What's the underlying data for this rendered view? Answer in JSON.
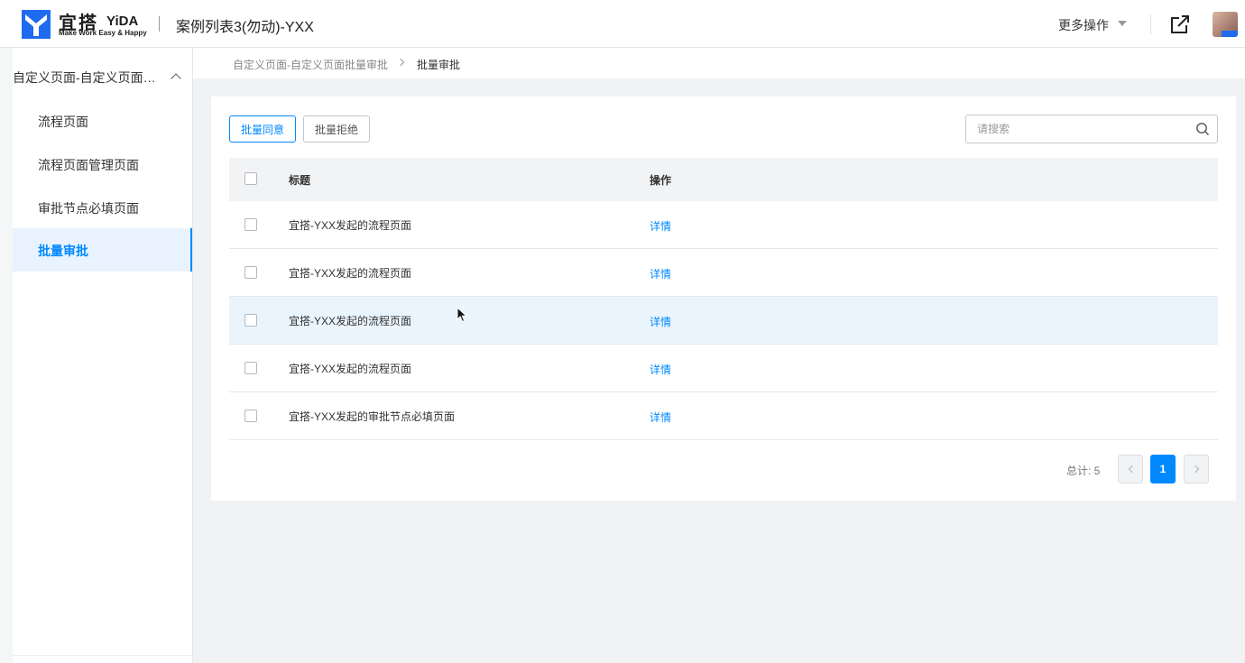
{
  "header": {
    "brand_cn": "宜搭",
    "brand_en": "YiDA",
    "brand_slogan": "Make Work Easy & Happy",
    "app_title": "案例列表3(勿动)-YXX",
    "more_ops": "更多操作",
    "logo_icon": "yida-logo-icon",
    "share_icon": "external-link-icon",
    "brand_color": "#1f6bf0"
  },
  "sidebar": {
    "group_title": "自定义页面-自定义页面批量审批",
    "items": [
      {
        "label": "流程页面"
      },
      {
        "label": "流程页面管理页面"
      },
      {
        "label": "审批节点必填页面"
      },
      {
        "label": "批量审批"
      }
    ],
    "active_index": 3,
    "accent": "#0089ff"
  },
  "breadcrumb": {
    "parent": "自定义页面-自定义页面批量审批",
    "current": "批量审批"
  },
  "toolbar": {
    "approve_label": "批量同意",
    "reject_label": "批量拒绝",
    "search_placeholder": "请搜索"
  },
  "table": {
    "columns": [
      "标题",
      "操作"
    ],
    "rows": [
      {
        "title": "宜搭-YXX发起的流程页面",
        "action": "详情"
      },
      {
        "title": "宜搭-YXX发起的流程页面",
        "action": "详情"
      },
      {
        "title": "宜搭-YXX发起的流程页面",
        "action": "详情"
      },
      {
        "title": "宜搭-YXX发起的流程页面",
        "action": "详情"
      },
      {
        "title": "宜搭-YXX发起的审批节点必填页面",
        "action": "详情"
      }
    ]
  },
  "pagination": {
    "total_label": "总计: 5",
    "current_page": "1"
  }
}
